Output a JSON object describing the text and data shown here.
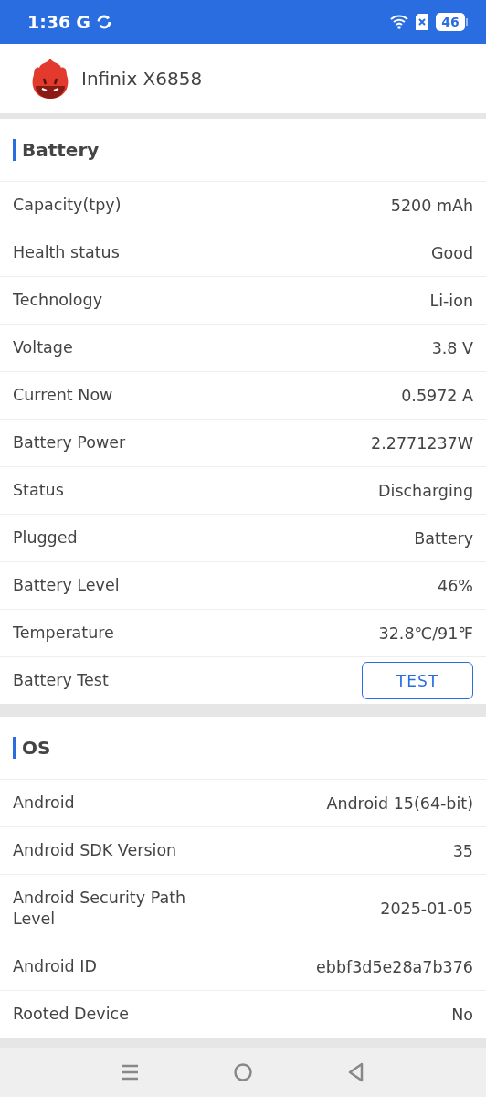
{
  "status_bar": {
    "time": "1:36",
    "network": "G",
    "battery": "46"
  },
  "header": {
    "title": "Infinix X6858"
  },
  "sections": [
    {
      "title": "Battery",
      "rows": [
        {
          "kind": "text",
          "label": "Capacity(tpy)",
          "value": "5200 mAh"
        },
        {
          "kind": "text",
          "label": "Health status",
          "value": "Good"
        },
        {
          "kind": "text",
          "label": "Technology",
          "value": "Li-ion"
        },
        {
          "kind": "text",
          "label": "Voltage",
          "value": "3.8 V"
        },
        {
          "kind": "text",
          "label": "Current Now",
          "value": "0.5972 A"
        },
        {
          "kind": "text",
          "label": "Battery Power",
          "value": "2.2771237W"
        },
        {
          "kind": "text",
          "label": "Status",
          "value": "Discharging"
        },
        {
          "kind": "text",
          "label": "Plugged",
          "value": "Battery"
        },
        {
          "kind": "text",
          "label": "Battery Level",
          "value": "46%"
        },
        {
          "kind": "text",
          "label": "Temperature",
          "value": "32.8℃/91℉"
        },
        {
          "kind": "button",
          "label": "Battery Test",
          "value": "TEST"
        }
      ]
    },
    {
      "title": "OS",
      "rows": [
        {
          "kind": "text",
          "label": "Android",
          "value": "Android 15(64-bit)"
        },
        {
          "kind": "text",
          "label": "Android SDK Version",
          "value": "35"
        },
        {
          "kind": "text",
          "label": "Android Security Path Level",
          "value": "2025-01-05"
        },
        {
          "kind": "text",
          "label": "Android ID",
          "value": "ebbf3d5e28a7b376"
        },
        {
          "kind": "text",
          "label": "Rooted Device",
          "value": "No"
        }
      ]
    }
  ]
}
